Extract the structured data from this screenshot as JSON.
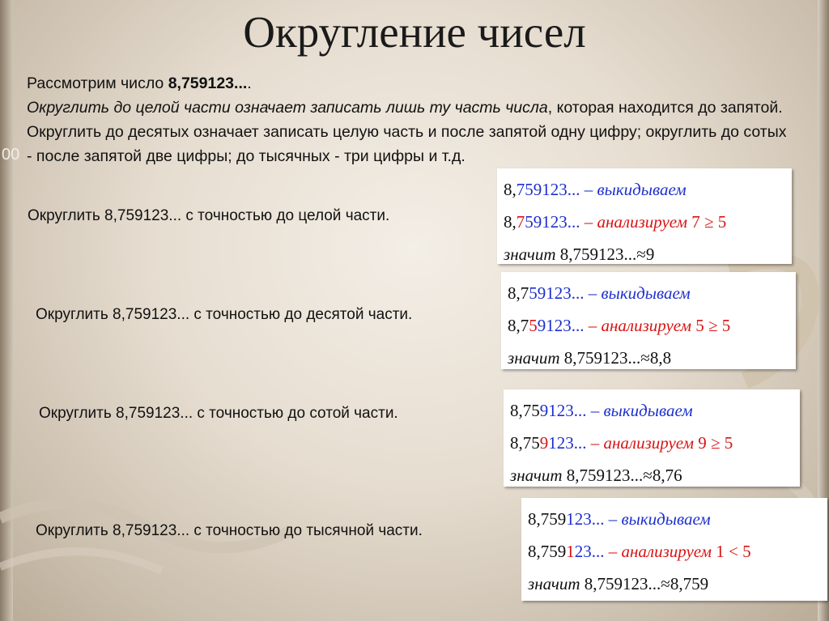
{
  "title": "Округление чисел",
  "intro": {
    "lead": "Рассмотрим число ",
    "number": "8,759123...",
    "dot": ".",
    "italic": "Округлить до целой части означает записать лишь ту часть числа",
    "rest": ", которая находится до запятой. Округлить до десятых означает записать целую часть и после запятой одну цифру; округлить до сотых - после запятой две цифры; до тысячных - три цифры и т.д."
  },
  "examples": [
    {
      "label": "Округлить 8,759123... с точностью до целой части.",
      "kept": "8",
      "sep": ",",
      "analyzed": "7",
      "dropped": "59123...",
      "discard_word": "– выкидываем",
      "analyze_word": "– анализируем",
      "condition": "7 ≥ 5",
      "result_word": "значит",
      "number": "8,759123...",
      "approx": "≈",
      "result": "9"
    },
    {
      "label": "Округлить 8,759123... с точностью до десятой части.",
      "kept": "8,7",
      "sep": "",
      "analyzed": "5",
      "dropped": "9123...",
      "discard_word": "– выкидываем",
      "analyze_word": "– анализируем",
      "condition": "5 ≥ 5",
      "result_word": "значит",
      "number": "8,759123...",
      "approx": "≈",
      "result": "8,8"
    },
    {
      "label": "Округлить 8,759123... с точностью до сотой части.",
      "kept": "8,75",
      "sep": "",
      "analyzed": "9",
      "dropped": "123...",
      "discard_word": "– выкидываем",
      "analyze_word": "– анализируем",
      "condition": "9 ≥ 5",
      "result_word": "значит",
      "number": "8,759123...",
      "approx": "≈",
      "result": "8,76"
    },
    {
      "label": "Округлить 8,759123... с точностью до тысячной части.",
      "kept": "8,759",
      "sep": "",
      "analyzed": "1",
      "dropped": "23...",
      "discard_word": "– выкидываем",
      "analyze_word": "– анализируем",
      "condition": "1 < 5",
      "result_word": "значит",
      "number": "8,759123...",
      "approx": "≈",
      "result": "8,759"
    }
  ],
  "decor_text": "00"
}
